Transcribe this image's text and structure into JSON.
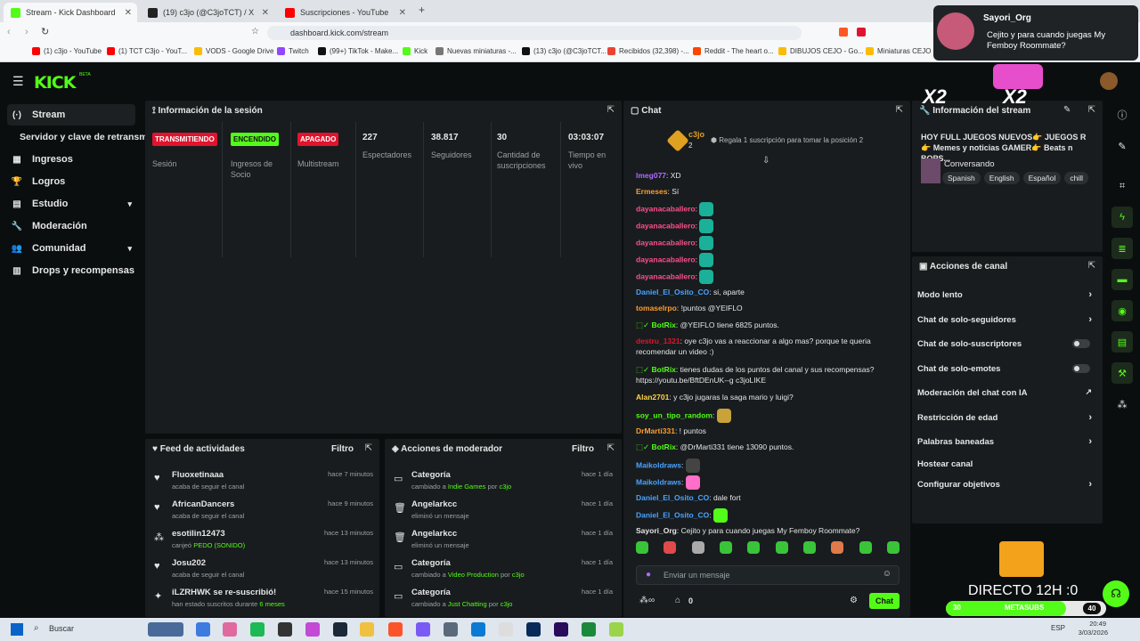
{
  "browser": {
    "tabs": [
      {
        "label": "Stream - Kick Dashboard",
        "color": "#53fc18"
      },
      {
        "label": "(19) c3jo (@C3joTCT) / X",
        "color": "#222222"
      },
      {
        "label": "Suscripciones - YouTube",
        "color": "#ff0000"
      }
    ],
    "url": "dashboard.kick.com/stream",
    "bookmarks": [
      {
        "label": "(1) c3jo - YouTube",
        "color": "#ff0000"
      },
      {
        "label": "(1) TCT C3jo - YouT...",
        "color": "#ff0000"
      },
      {
        "label": "VODS - Google Drive",
        "color": "#fbbc04"
      },
      {
        "label": "Twitch",
        "color": "#9146ff"
      },
      {
        "label": "(99+) TikTok - Make...",
        "color": "#111111"
      },
      {
        "label": "Kick",
        "color": "#53fc18"
      },
      {
        "label": "Nuevas miniaturas -...",
        "color": "#777777"
      },
      {
        "label": "(13) c3jo (@C3joTCT...",
        "color": "#111111"
      },
      {
        "label": "Recibidos (32,398) -...",
        "color": "#ea4335"
      },
      {
        "label": "Reddit - The heart o...",
        "color": "#ff4500"
      },
      {
        "label": "DIBUJOS CEJO - Go...",
        "color": "#fbbc04"
      },
      {
        "label": "Miniaturas CEJO - G...",
        "color": "#fbbc04"
      }
    ]
  },
  "notification": {
    "user": "Sayori_Org",
    "text": "Cejito y para cuando juegas My Femboy Roommate?"
  },
  "kick": {
    "logo": "KICK",
    "beta": "BETA"
  },
  "sidebar": {
    "items": [
      {
        "label": "Stream",
        "icon": "broadcast-icon",
        "glyph": "(·)"
      },
      {
        "label": "Servidor y clave de retransmisión",
        "icon": "",
        "glyph": ""
      },
      {
        "label": "Ingresos",
        "icon": "chart-icon",
        "glyph": "▦"
      },
      {
        "label": "Logros",
        "icon": "trophy-icon",
        "glyph": "🏆"
      },
      {
        "label": "Estudio",
        "icon": "studio-icon",
        "glyph": "▤"
      },
      {
        "label": "Moderación",
        "icon": "wrench-icon",
        "glyph": "🔧"
      },
      {
        "label": "Comunidad",
        "icon": "community-icon",
        "glyph": "👥"
      },
      {
        "label": "Drops y recompensas",
        "icon": "drops-icon",
        "glyph": "▥"
      }
    ]
  },
  "session": {
    "title": "Información de la sesión",
    "stats": [
      {
        "value": "TRANSMITIENDO",
        "label": "Sesión",
        "badge": "#e0142e"
      },
      {
        "value": "ENCENDIDO",
        "label": "Ingresos de Socio",
        "badge": "#53fc18"
      },
      {
        "value": "APAGADO",
        "label": "Multistream",
        "badge": "#e0142e"
      },
      {
        "value": "227",
        "label": "Espectadores",
        "badge": ""
      },
      {
        "value": "38.817",
        "label": "Seguidores",
        "badge": ""
      },
      {
        "value": "30",
        "label": "Cantidad de suscripciones",
        "badge": ""
      },
      {
        "value": "03:03:07",
        "label": "Tiempo en vivo",
        "badge": ""
      }
    ]
  },
  "feed": {
    "title": "Feed de actividades",
    "filter": "Filtro",
    "rows": [
      {
        "name": "Fluoxetinaaa",
        "sub": "acaba de seguir el canal",
        "time": "hace 7 minutos",
        "icon": "heart-icon",
        "glyph": "♥",
        "hl": ""
      },
      {
        "name": "AfricanDancers",
        "sub": "acaba de seguir el canal",
        "time": "hace 9 minutos",
        "icon": "heart-icon",
        "glyph": "♥",
        "hl": ""
      },
      {
        "name": "esotilin12473",
        "sub": "canjeó",
        "time": "hace 13 minutos",
        "icon": "redeem-icon",
        "glyph": "⁂",
        "hl": "PEDO (SONIDO)"
      },
      {
        "name": "Josu202",
        "sub": "acaba de seguir el canal",
        "time": "hace 13 minutos",
        "icon": "heart-icon",
        "glyph": "♥",
        "hl": ""
      },
      {
        "name": "iLZRHWK se re-suscribió!",
        "sub": "han estado suscritos durante",
        "time": "hace 15 minutos",
        "icon": "star-icon",
        "glyph": "✦",
        "hl": "6 meses"
      }
    ]
  },
  "modactions": {
    "title": "Acciones de moderador",
    "filter": "Filtro",
    "rows": [
      {
        "name": "Categoría",
        "sub": "cambiado a",
        "hl": "Indie Games",
        "by": "por",
        "who": "c3jo",
        "time": "hace 1 día",
        "icon": "category-icon",
        "glyph": "▭"
      },
      {
        "name": "Angelarkcc",
        "sub": "eliminó un mensaje",
        "hl": "",
        "by": "",
        "who": "",
        "time": "hace 1 día",
        "icon": "trash-icon",
        "glyph": "🗑"
      },
      {
        "name": "Angelarkcc",
        "sub": "eliminó un mensaje",
        "hl": "",
        "by": "",
        "who": "",
        "time": "hace 1 día",
        "icon": "trash-icon",
        "glyph": "🗑"
      },
      {
        "name": "Categoría",
        "sub": "cambiado a",
        "hl": "Video Production",
        "by": "por",
        "who": "c3jo",
        "time": "hace 1 día",
        "icon": "category-icon",
        "glyph": "▭"
      },
      {
        "name": "Categoría",
        "sub": "cambiado a",
        "hl": "Just Chatting",
        "by": "por",
        "who": "c3jo",
        "time": "hace 1 día",
        "icon": "category-icon",
        "glyph": "▭"
      }
    ]
  },
  "chat": {
    "title": "Chat",
    "pinned_user": "c3jo",
    "pinned_count": "2",
    "gift_text": "Regala 1 suscripción para tomar la posición 2",
    "messages": [
      {
        "user": "lmeg077",
        "color": "#b06bff",
        "text": "XD",
        "bot": false,
        "emote": ""
      },
      {
        "user": "Ermeses",
        "color": "#ff9d2b",
        "text": "Sí",
        "bot": false,
        "emote": ""
      },
      {
        "user": "dayanacaballero",
        "color": "#ff4f8b",
        "text": "",
        "bot": false,
        "emote": "#1ab09a"
      },
      {
        "user": "dayanacaballero",
        "color": "#ff4f8b",
        "text": "",
        "bot": false,
        "emote": "#1ab09a"
      },
      {
        "user": "dayanacaballero",
        "color": "#ff4f8b",
        "text": "",
        "bot": false,
        "emote": "#1ab09a"
      },
      {
        "user": "dayanacaballero",
        "color": "#ff4f8b",
        "text": "",
        "bot": false,
        "emote": "#1ab09a"
      },
      {
        "user": "dayanacaballero",
        "color": "#ff4f8b",
        "text": "",
        "bot": false,
        "emote": "#1ab09a"
      },
      {
        "user": "Daniel_El_Osito_CO",
        "color": "#4aa3ff",
        "text": "si, aparte",
        "bot": false,
        "emote": ""
      },
      {
        "user": "tomaselrpo",
        "color": "#ff9d2b",
        "text": "!puntos @YEIFLO",
        "bot": false,
        "emote": ""
      },
      {
        "user": "BotRix",
        "color": "#53fc18",
        "text": "@YEIFLO tiene 6825 puntos.",
        "bot": true,
        "emote": ""
      },
      {
        "user": "destru_1321",
        "color": "#e0142e",
        "text": "oye c3jo vas a reaccionar a algo mas? porque te queria recomendar un video :)",
        "bot": false,
        "emote": ""
      },
      {
        "user": "BotRix",
        "color": "#53fc18",
        "text": "tienes dudas de los puntos del canal y sus recompensas? https://youtu.be/BftDEnUK--g c3joLIKE",
        "bot": true,
        "emote": ""
      },
      {
        "user": "Alan2701",
        "color": "#ffd24a",
        "text": "y c3jo jugaras la saga mario y luigi?",
        "bot": false,
        "emote": ""
      },
      {
        "user": "soy_un_tipo_random",
        "color": "#53fc18",
        "text": "",
        "bot": false,
        "emote": "#c9a23a"
      },
      {
        "user": "DrMarti331",
        "color": "#ff9d2b",
        "text": "! puntos",
        "bot": false,
        "emote": ""
      },
      {
        "user": "BotRix",
        "color": "#53fc18",
        "text": "@DrMarti331 tiene 13090 puntos.",
        "bot": true,
        "emote": ""
      },
      {
        "user": "Maikoldraws",
        "color": "#4aa3ff",
        "text": "",
        "bot": false,
        "emote": "#444444"
      },
      {
        "user": "Maikoldraws",
        "color": "#4aa3ff",
        "text": "",
        "bot": false,
        "emote": "#ff6ec7"
      },
      {
        "user": "Daniel_El_Osito_CO",
        "color": "#4aa3ff",
        "text": "dale fort",
        "bot": false,
        "emote": ""
      },
      {
        "user": "Daniel_El_Osito_CO",
        "color": "#4aa3ff",
        "text": "",
        "bot": false,
        "emote": "#53fc18"
      },
      {
        "user": "Sayori_Org",
        "color": "#e6e6e6",
        "text": "Cejito y para cuando juegas My Femboy Roommate?",
        "bot": false,
        "emote": ""
      }
    ],
    "input_placeholder": "Enviar un mensaje",
    "points": "0",
    "send_label": "Chat"
  },
  "streaminfo": {
    "title": "Información del stream",
    "stream_title": "HOY FULL JUEGOS NUEVOS👉 JUEGOS R👉 Memes y noticias GAMER👉 Beats n BOPS...",
    "category": "Conversando",
    "tags": [
      "Spanish",
      "English",
      "Español",
      "chill"
    ]
  },
  "channel": {
    "title": "Acciones de canal",
    "items": [
      {
        "label": "Modo lento",
        "kind": "arrow"
      },
      {
        "label": "Chat de solo-seguidores",
        "kind": "arrow"
      },
      {
        "label": "Chat de solo-suscriptores",
        "kind": "toggle"
      },
      {
        "label": "Chat de solo-emotes",
        "kind": "toggle"
      },
      {
        "label": "Moderación del chat con IA",
        "kind": "external"
      },
      {
        "label": "Restricción de edad",
        "kind": "arrow"
      },
      {
        "label": "Palabras baneadas",
        "kind": "arrow"
      },
      {
        "label": "Hostear canal",
        "kind": "none"
      },
      {
        "label": "Configurar objetivos",
        "kind": "arrow"
      }
    ]
  },
  "overlay": {
    "multiplier1": "X2",
    "multiplier2": "X2",
    "directo": "DIRECTO 12H :0",
    "bar_left": "30",
    "bar_label": "METASUBS",
    "bar_right": "40",
    "bar_progress": 0.75
  },
  "taskbar": {
    "search": "Buscar",
    "lang": "ESP",
    "time": "20:49",
    "date": "3/03/2026"
  }
}
